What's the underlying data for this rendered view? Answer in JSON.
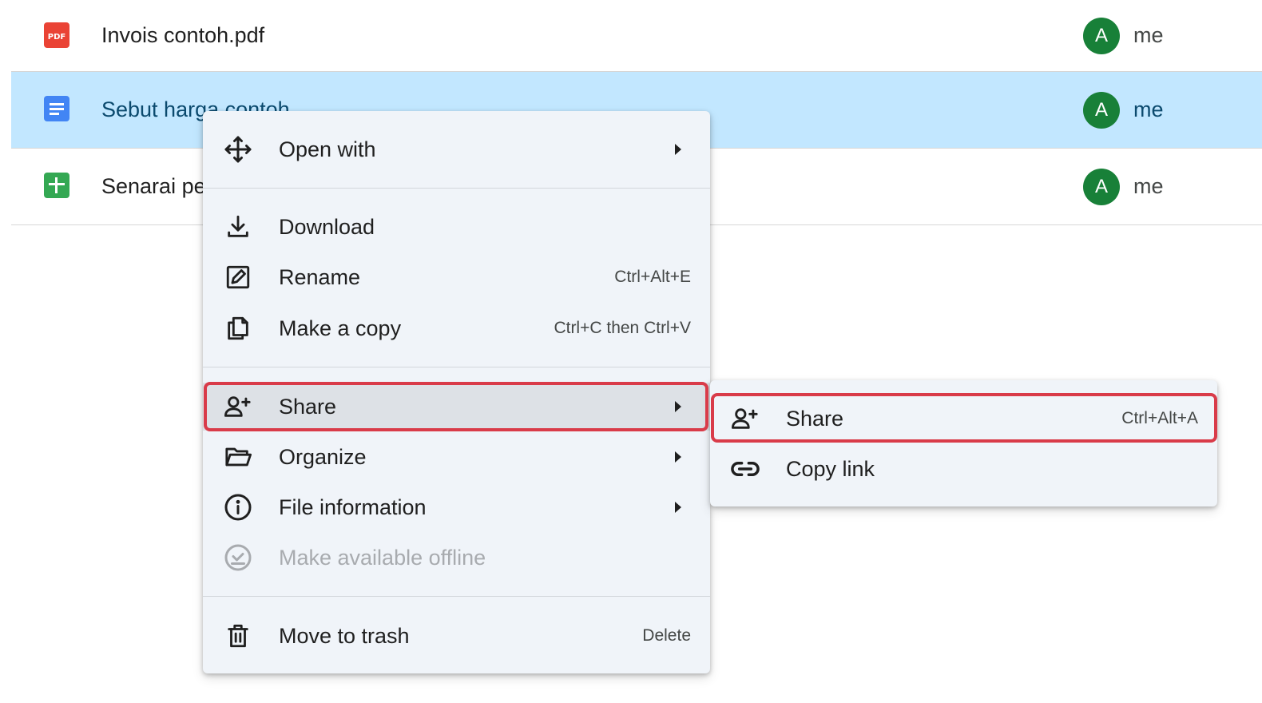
{
  "files": [
    {
      "name": "Invois contoh.pdf",
      "type": "pdf",
      "icon": "pdf-icon",
      "owner_initial": "A",
      "owner": "me",
      "selected": false
    },
    {
      "name": "Sebut harga contoh",
      "type": "doc",
      "icon": "google-docs-icon",
      "owner_initial": "A",
      "owner": "me",
      "selected": true
    },
    {
      "name": "Senarai pe",
      "type": "sheet",
      "icon": "google-sheets-icon",
      "owner_initial": "A",
      "owner": "me",
      "selected": false
    }
  ],
  "context_menu": {
    "items": [
      {
        "label": "Open with",
        "icon": "move-arrows-icon",
        "shortcut": "",
        "submenu": true
      },
      {
        "label": "Download",
        "icon": "download-icon",
        "shortcut": "",
        "submenu": false
      },
      {
        "label": "Rename",
        "icon": "rename-icon",
        "shortcut": "Ctrl+Alt+E",
        "submenu": false
      },
      {
        "label": "Make a copy",
        "icon": "copy-icon",
        "shortcut": "Ctrl+C then Ctrl+V",
        "submenu": false
      },
      {
        "label": "Share",
        "icon": "person-add-icon",
        "shortcut": "",
        "submenu": true,
        "active": true
      },
      {
        "label": "Organize",
        "icon": "folder-open-icon",
        "shortcut": "",
        "submenu": true
      },
      {
        "label": "File information",
        "icon": "info-icon",
        "shortcut": "",
        "submenu": true
      },
      {
        "label": "Make available offline",
        "icon": "offline-check-icon",
        "shortcut": "",
        "submenu": false,
        "disabled": true
      },
      {
        "label": "Move to trash",
        "icon": "trash-icon",
        "shortcut": "Delete",
        "submenu": false
      }
    ]
  },
  "share_submenu": {
    "items": [
      {
        "label": "Share",
        "icon": "person-add-icon",
        "shortcut": "Ctrl+Alt+A"
      },
      {
        "label": "Copy link",
        "icon": "link-icon",
        "shortcut": ""
      }
    ]
  },
  "colors": {
    "selected_row": "#c2e7ff",
    "menu_bg": "#f0f4f9",
    "highlight": "#d93b49",
    "avatar": "#188038"
  }
}
